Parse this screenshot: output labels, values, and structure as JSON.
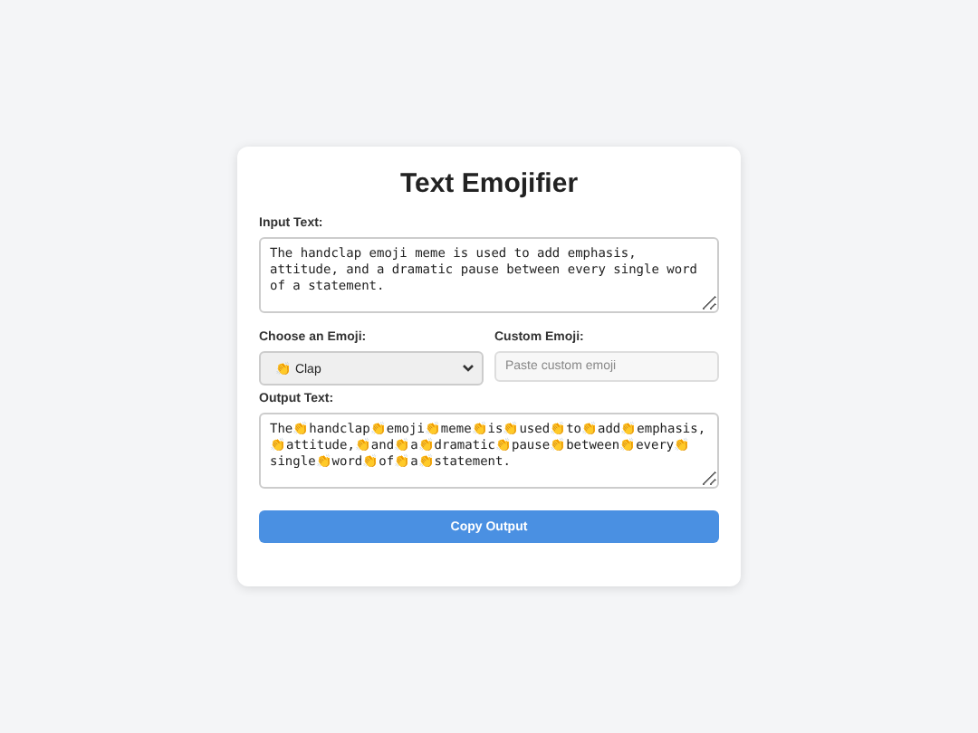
{
  "title": "Text Emojifier",
  "input": {
    "label": "Input Text:",
    "value": "The handclap emoji meme is used to add emphasis, attitude, and a dramatic pause between every single word of a statement."
  },
  "emoji_select": {
    "label": "Choose an Emoji:",
    "value": "👏 Clap"
  },
  "custom_emoji": {
    "label": "Custom Emoji:",
    "placeholder": "Paste custom emoji"
  },
  "output": {
    "label": "Output Text:",
    "value": "The👏handclap👏emoji👏meme👏is👏used👏to👏add👏emphasis,👏attitude,👏and👏a👏dramatic👏pause👏between👏every👏single👏word👏of👏a👏statement."
  },
  "button": "Copy Output"
}
